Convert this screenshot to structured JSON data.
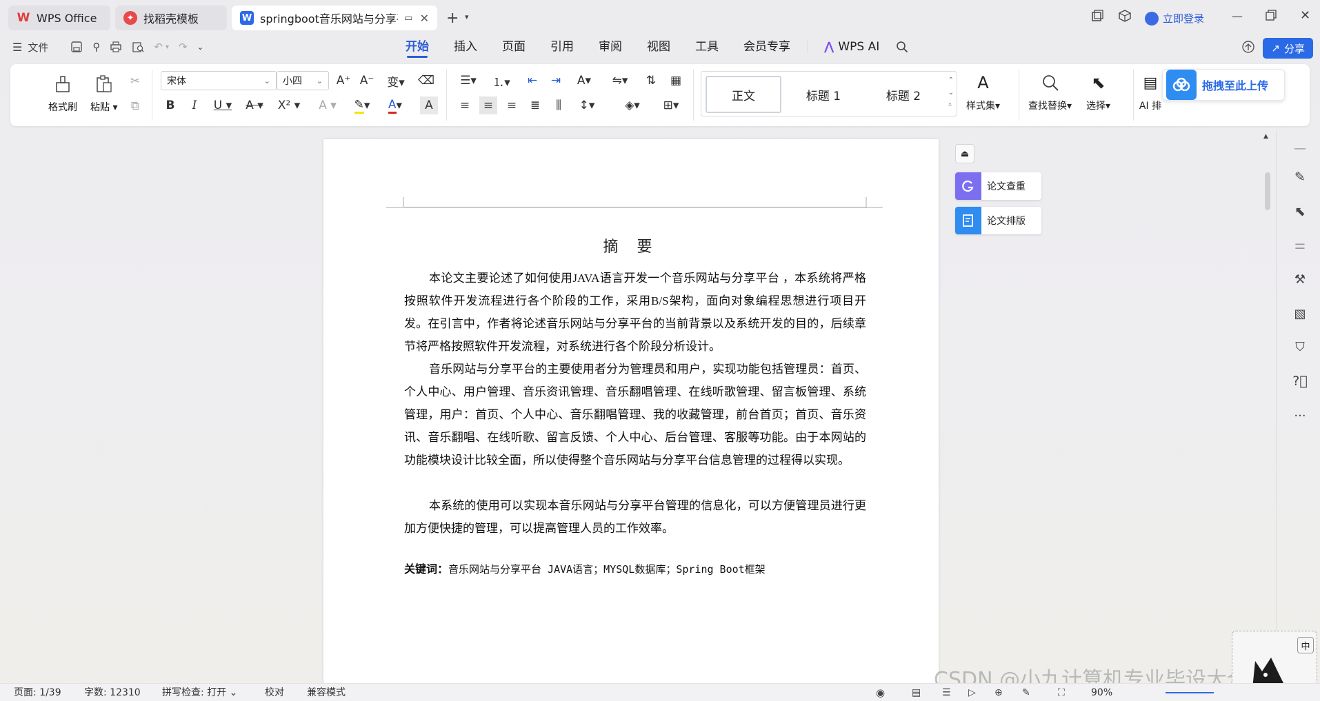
{
  "tabs": [
    {
      "label": "WPS Office"
    },
    {
      "label": "找稻壳模板"
    },
    {
      "label": "springboot音乐网站与分享平"
    }
  ],
  "account": {
    "login_label": "立即登录"
  },
  "menu": {
    "file_label": "文件",
    "tabs": [
      "开始",
      "插入",
      "页面",
      "引用",
      "审阅",
      "视图",
      "工具",
      "会员专享",
      "WPS AI"
    ],
    "share_label": "分享"
  },
  "ribbon": {
    "format_painter": "格式刷",
    "paste": "粘贴",
    "font_name": "宋体",
    "font_size": "小四",
    "styles": [
      "正文",
      "标题 1",
      "标题 2"
    ],
    "styles_set": "样式集",
    "find_replace": "查找替换",
    "select": "选择",
    "ai_layout": "AI 排",
    "upload_label": "拖拽至此上传"
  },
  "side_buttons": {
    "check_label": "论文查重",
    "format_label": "论文排版"
  },
  "document": {
    "title": "摘 要",
    "paragraphs": [
      "本论文主要论述了如何使用JAVA语言开发一个音乐网站与分享平台 ，本系统将严格按照软件开发流程进行各个阶段的工作，采用B/S架构，面向对象编程思想进行项目开发。在引言中，作者将论述音乐网站与分享平台的当前背景以及系统开发的目的，后续章节将严格按照软件开发流程，对系统进行各个阶段分析设计。",
      "音乐网站与分享平台的主要使用者分为管理员和用户，实现功能包括管理员：首页、个人中心、用户管理、音乐资讯管理、音乐翻唱管理、在线听歌管理、留言板管理、系统管理，用户：首页、个人中心、音乐翻唱管理、我的收藏管理，前台首页；首页、音乐资讯、音乐翻唱、在线听歌、留言反馈、个人中心、后台管理、客服等功能。由于本网站的功能模块设计比较全面，所以使得整个音乐网站与分享平台信息管理的过程得以实现。",
      "本系统的使用可以实现本音乐网站与分享平台管理的信息化，可以方便管理员进行更加方便快捷的管理，可以提高管理人员的工作效率。"
    ],
    "keywords_label": "关键词：",
    "keywords_text": "音乐网站与分享平台 JAVA语言；MYSQL数据库；Spring  Boot框架"
  },
  "status": {
    "page": "页面: 1/39",
    "words": "字数: 12310",
    "spell": "拼写检查: 打开",
    "proof": "校对",
    "compat": "兼容模式",
    "zoom": "90%"
  },
  "watermark": "CSDN @小九计算机专业毕设大全",
  "ime_label": "中",
  "colors": {
    "accent": "#2b5cd6",
    "share_bg": "#2b6ae6",
    "check_icon": "#7b6ff0",
    "format_icon": "#2f8cf0"
  }
}
